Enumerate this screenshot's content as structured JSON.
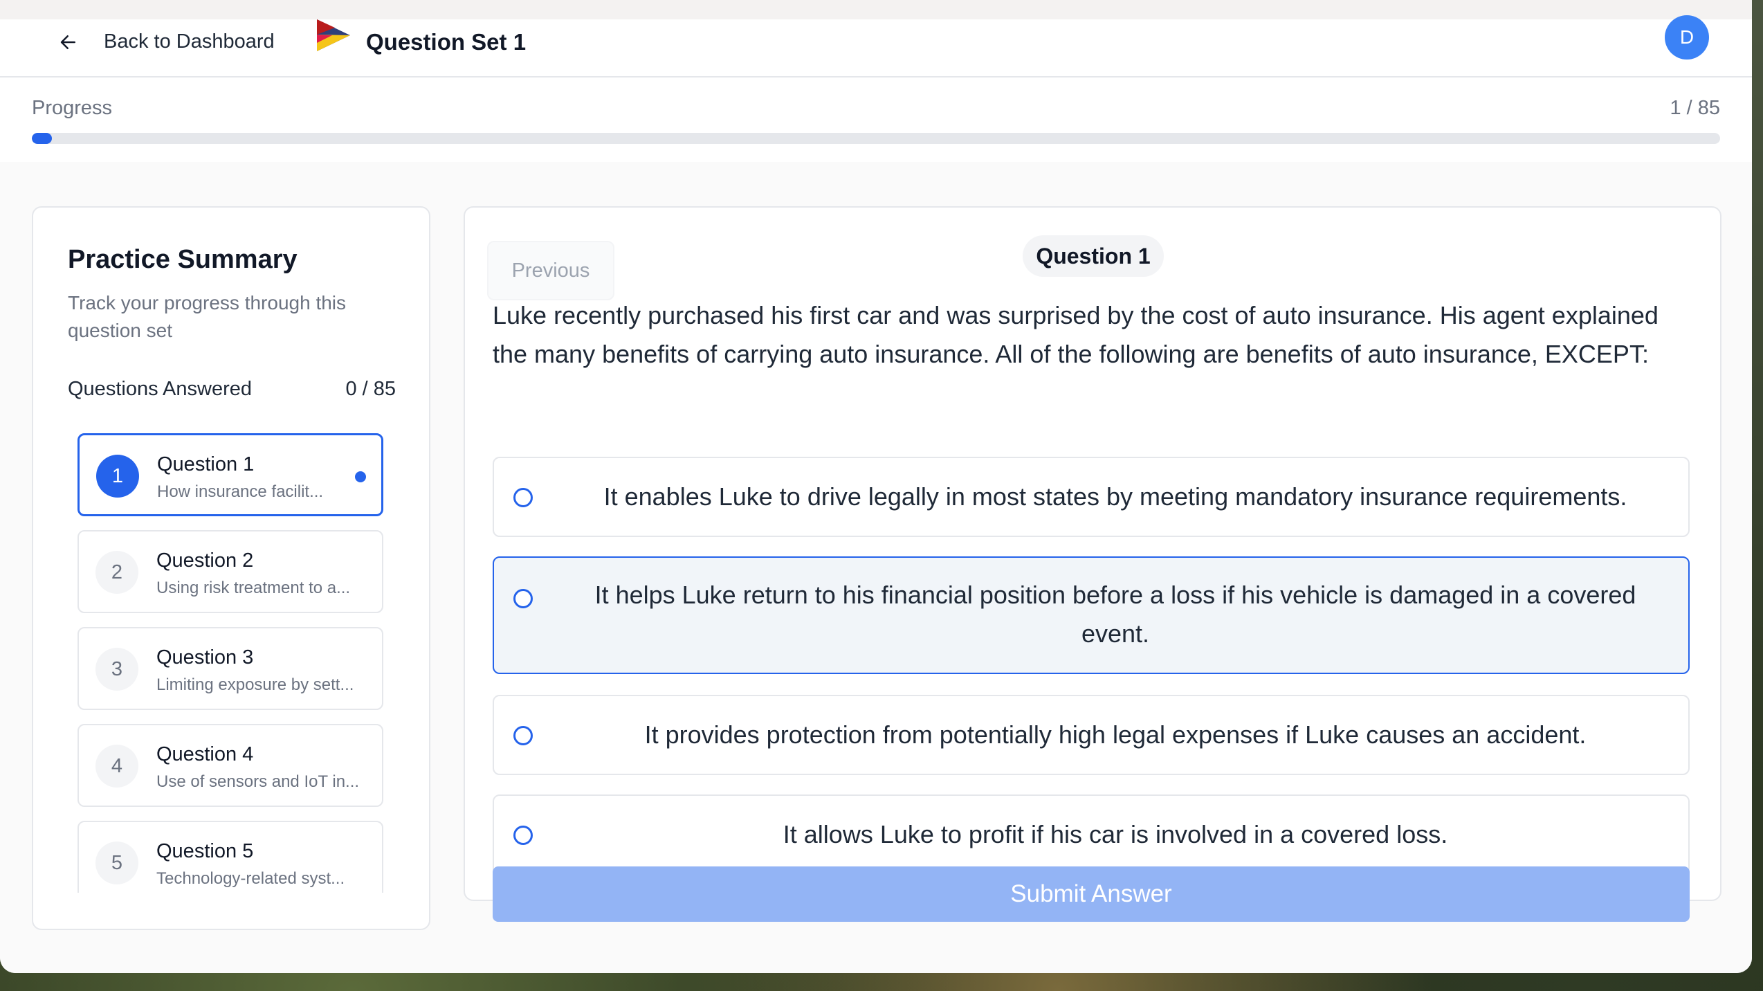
{
  "header": {
    "back_label": "Back to Dashboard",
    "set_title": "Question Set 1",
    "avatar_initial": "D"
  },
  "progress": {
    "label": "Progress",
    "count": "1 / 85",
    "fraction": 0.0118
  },
  "summary": {
    "title": "Practice Summary",
    "subtitle": "Track your progress through this question set",
    "answered_label": "Questions Answered",
    "answered_count": "0 / 85",
    "questions": [
      {
        "num": "1",
        "title": "Question 1",
        "desc": "How insurance facilit..."
      },
      {
        "num": "2",
        "title": "Question 2",
        "desc": "Using risk treatment to a..."
      },
      {
        "num": "3",
        "title": "Question 3",
        "desc": "Limiting exposure by sett..."
      },
      {
        "num": "4",
        "title": "Question 4",
        "desc": "Use of sensors and IoT in..."
      },
      {
        "num": "5",
        "title": "Question 5",
        "desc": "Technology-related syst..."
      }
    ]
  },
  "question": {
    "previous_label": "Previous",
    "badge": "Question 1",
    "text": "Luke recently purchased his first car and was surprised by the cost of auto insurance. His agent explained the many benefits of carrying auto insurance. All of the following are benefits of auto insurance, EXCEPT:",
    "options": [
      "It enables Luke to drive legally in most states by meeting mandatory insurance requirements.",
      "It helps Luke return to his financial position before a loss if his vehicle is damaged in a covered event.",
      "It provides protection from potentially high legal expenses if Luke causes an accident.",
      "It allows Luke to profit if his car is involved in a covered loss."
    ],
    "submit_label": "Submit Answer"
  },
  "colors": {
    "accent": "#2563eb",
    "submit_disabled": "#93b4f5"
  }
}
